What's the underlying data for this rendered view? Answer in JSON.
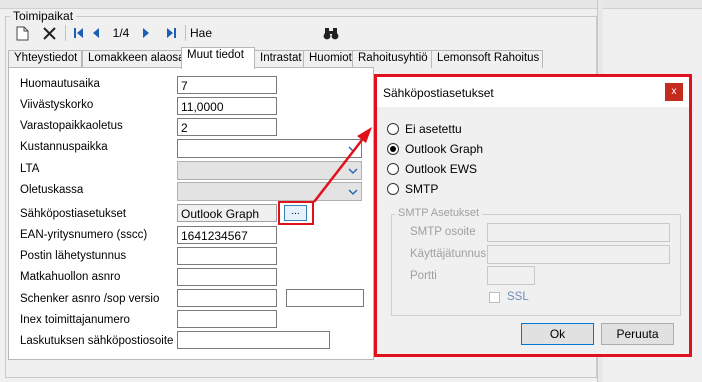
{
  "group_title": "Toimipaikat",
  "toolbar": {
    "record_pos": "1/4",
    "search_label": "Hae"
  },
  "tabs": [
    "Yhteystiedot",
    "Lomakkeen alaosa",
    "Muut tiedot",
    "Intrastat",
    "Huomiot",
    "Rahoitusyhtiö",
    "Lemonsoft Rahoitus"
  ],
  "active_tab": "Muut tiedot",
  "form": {
    "huomautusaika_label": "Huomautusaika",
    "huomautusaika_value": "7",
    "viivastyskorko_label": "Viivästyskorko",
    "viivastyskorko_value": "11,0000",
    "varastopaikkaoletus_label": "Varastopaikkaoletus",
    "varastopaikkaoletus_value": "2",
    "kustannuspaikka_label": "Kustannuspaikka",
    "lta_label": "LTA",
    "oletuskassa_label": "Oletuskassa",
    "sahkoposti_label": "Sähköpostiasetukset",
    "sahkoposti_value": "Outlook Graph",
    "browse_label": "...",
    "ean_label": "EAN-yritysnumero (sscc)",
    "ean_value": "1641234567",
    "postin_label": "Postin lähetystunnus",
    "matkahuolto_label": "Matkahuollon asnro",
    "schenker_label": "Schenker asnro /sop versio",
    "inex_label": "Inex toimittajanumero",
    "laskutus_label": "Laskutuksen sähköpostiosoite"
  },
  "dialog": {
    "title": "Sähköpostiasetukset",
    "close": "x",
    "options": [
      "Ei asetettu",
      "Outlook Graph",
      "Outlook EWS",
      "SMTP"
    ],
    "selected": "Outlook Graph",
    "smtp_group": "SMTP Asetukset",
    "smtp_address_label": "SMTP osoite",
    "username_label": "Käyttäjätunnus",
    "port_label": "Portti",
    "ssl_label": "SSL",
    "ok": "Ok",
    "cancel": "Peruuta"
  },
  "colors": {
    "highlight": "#e0101c",
    "nav_blue": "#1a5fb4"
  },
  "icons": [
    "new-document-icon",
    "delete-icon",
    "first-record-icon",
    "prev-record-icon",
    "next-record-icon",
    "last-record-icon",
    "binoculars-icon",
    "chevron-down-icon"
  ]
}
